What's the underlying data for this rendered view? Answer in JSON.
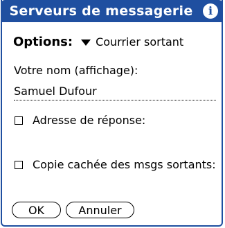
{
  "dialog": {
    "title": "Serveurs de messagerie",
    "info_icon": "i"
  },
  "options": {
    "label": "Options:",
    "selected": "Courrier sortant"
  },
  "name": {
    "label": "Votre nom (affichage):",
    "value": "Samuel Dufour"
  },
  "reply_to": {
    "label": "Adresse de réponse:",
    "checked": false
  },
  "bcc": {
    "label": "Copie cachée des msgs sortants:",
    "checked": false
  },
  "buttons": {
    "ok": "OK",
    "cancel": "Annuler"
  },
  "colors": {
    "title_bar": "#1f4fa0",
    "background": "#ffffff"
  }
}
